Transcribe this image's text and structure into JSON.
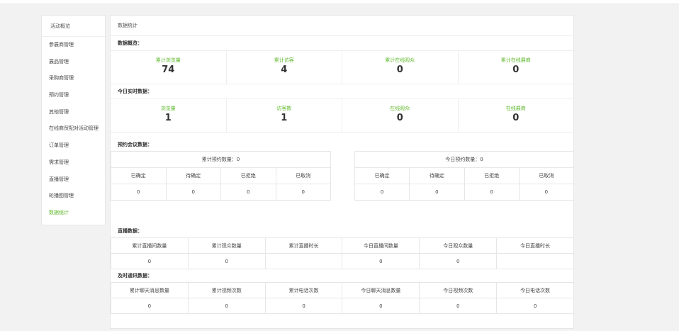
{
  "sidebar": {
    "header": "活动概览",
    "items": [
      "参展商管理",
      "展品管理",
      "采购商管理",
      "预约管理",
      "其他管理",
      "在线商贸配对活动管理",
      "订单管理",
      "需求管理",
      "直播管理",
      "轮播图管理",
      "数据统计"
    ],
    "active_index": 10
  },
  "main": {
    "title": "数据统计",
    "overview": {
      "title": "数据概览：",
      "stats": [
        {
          "label": "累计浏览量",
          "value": "74"
        },
        {
          "label": "累计访客",
          "value": "4"
        },
        {
          "label": "累计在线观众",
          "value": "0"
        },
        {
          "label": "累计在线展商",
          "value": "0"
        }
      ]
    },
    "today": {
      "title": "今日实时数据：",
      "stats": [
        {
          "label": "浏览量",
          "value": "1"
        },
        {
          "label": "访客数",
          "value": "1"
        },
        {
          "label": "在线观众",
          "value": "0"
        },
        {
          "label": "在线展商",
          "value": "0"
        }
      ]
    },
    "reservation": {
      "title": "预约会议数据：",
      "total": {
        "caption": "累计预约数量：0",
        "headers": [
          "已确定",
          "待确定",
          "已拒绝",
          "已取消"
        ],
        "values": [
          "0",
          "0",
          "0",
          "0"
        ]
      },
      "today": {
        "caption": "今日预约数量：0",
        "headers": [
          "已确定",
          "待确定",
          "已拒绝",
          "已取消"
        ],
        "values": [
          "0",
          "0",
          "0",
          "0"
        ]
      }
    },
    "live": {
      "title": "直播数据：",
      "headers": [
        "累计直播间数量",
        "累计观众数量",
        "累计直播时长",
        "今日直播间数量",
        "今日观众数量",
        "今日直播时长"
      ],
      "values": [
        "0",
        "0",
        "",
        "0",
        "0",
        ""
      ]
    },
    "im": {
      "title": "及时通讯数据：",
      "headers": [
        "累计聊天消息数量",
        "累计视频次数",
        "累计电话次数",
        "今日聊天消息数量",
        "今日视频次数",
        "今日电话次数"
      ],
      "values": [
        "0",
        "0",
        "0",
        "0",
        "0",
        "0"
      ]
    }
  }
}
